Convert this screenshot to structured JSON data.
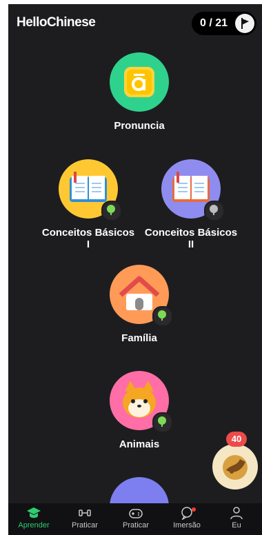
{
  "header": {
    "brand": "HelloChinese",
    "progress": "0 / 21"
  },
  "lessons": [
    {
      "label": "Pronuncia",
      "icon": "pronunciation-icon",
      "color": "#2fd28c"
    },
    {
      "label": "Conceitos Básicos I",
      "icon": "book-icon",
      "color": "#ffc833"
    },
    {
      "label": "Conceitos Básicos II",
      "icon": "book-icon",
      "color": "#8f8cf0"
    },
    {
      "label": "Família",
      "icon": "house-icon",
      "color": "#ff9b57"
    },
    {
      "label": "Animais",
      "icon": "dog-icon",
      "color": "#ff6ea6"
    }
  ],
  "fab": {
    "count": "40"
  },
  "tabbar": {
    "items": [
      {
        "label": "Aprender",
        "icon": "graduation-cap-icon",
        "active": true
      },
      {
        "label": "Praticar",
        "icon": "dumbbell-icon"
      },
      {
        "label": "Praticar",
        "icon": "gamepad-icon"
      },
      {
        "label": "Imersão",
        "icon": "chat-bubble-icon"
      },
      {
        "label": "Eu",
        "icon": "user-icon"
      }
    ]
  },
  "colors": {
    "background": "#1d1d1f",
    "accent": "#2ecc71",
    "badge_red": "#ec4b4b"
  }
}
